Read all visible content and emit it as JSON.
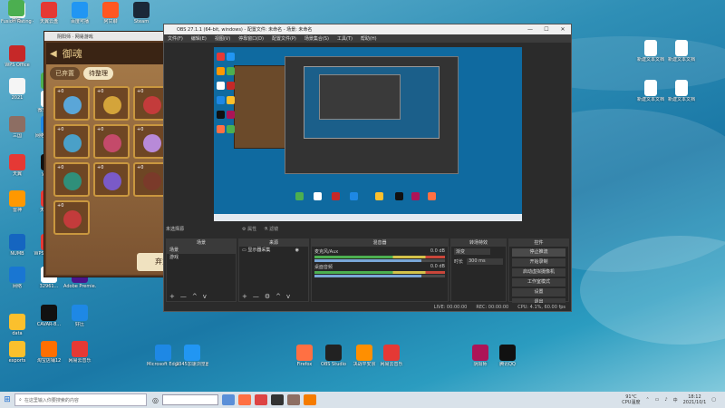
{
  "desktop_icons_left": [
    {
      "label": "Fusion Rating 4",
      "color": "#ffffff"
    },
    {
      "label": "天翼云盘",
      "color": "#e53935"
    },
    {
      "label": "百度可播",
      "color": "#2196f3"
    },
    {
      "label": "阿甘聊",
      "color": "#ff5722"
    },
    {
      "label": "Steam",
      "color": "#1b2838"
    },
    {
      "label": "WPS Office",
      "color": "#c62828"
    },
    {
      "label": "微信",
      "color": "#4caf50"
    },
    {
      "label": "2021",
      "color": "#f5f5f5"
    },
    {
      "label": "微软输入法",
      "color": "#ffffff"
    },
    {
      "label": "三国",
      "color": "#8d6e63"
    },
    {
      "label": "网络电视直播",
      "color": "#1e88e5"
    },
    {
      "label": "天翼",
      "color": "#e53935"
    },
    {
      "label": "yyskia",
      "color": "#111111"
    },
    {
      "label": "雷神",
      "color": "#ff9800"
    },
    {
      "label": "天翼云盘",
      "color": "#e53935"
    },
    {
      "label": "NUMB",
      "color": "#1565c0"
    },
    {
      "label": "WPS图片-客户",
      "color": "#e53935"
    },
    {
      "label": "网络",
      "color": "#1976d2"
    },
    {
      "label": "32961...",
      "color": "#ffffff"
    },
    {
      "label": "Adobe Premie...",
      "color": "#4a148c"
    },
    {
      "label": "data",
      "color": "#fbc02d"
    },
    {
      "label": "CAVAR-8...",
      "color": "#111111"
    },
    {
      "label": "好压",
      "color": "#1e88e5"
    },
    {
      "label": "exports",
      "color": "#fbc02d"
    },
    {
      "label": "淘宝店铺12",
      "color": "#ff6f00"
    },
    {
      "label": "网易云音乐",
      "color": "#e53935"
    },
    {
      "label": "Microsoft Edge",
      "color": "#1e88e5"
    },
    {
      "label": "2345加速浏览器",
      "color": "#2196f3"
    },
    {
      "label": "Firefox",
      "color": "#ff7043"
    },
    {
      "label": "OBS Studio",
      "color": "#222222"
    },
    {
      "label": "决战平安京",
      "color": "#ff8f00"
    },
    {
      "label": "网易云音乐",
      "color": "#e53935"
    },
    {
      "label": "阴阳师",
      "color": "#ad1457"
    },
    {
      "label": "腾讯QQ",
      "color": "#111111"
    },
    {
      "label": "微信",
      "color": "#4caf50"
    }
  ],
  "desktop_icons_right": [
    {
      "label": "新建文本文档",
      "color": "#ffffff"
    },
    {
      "label": "新建文本文档",
      "color": "#ffffff"
    },
    {
      "label": "",
      "color": "#a5d6a7"
    },
    {
      "label": "新建文本文档",
      "color": "#ffffff"
    },
    {
      "label": "新建文本文档",
      "color": "#ffffff"
    }
  ],
  "game": {
    "window_title": "阴阳师 · 网易游戏",
    "header": "御魂",
    "count": "43",
    "tabs": [
      "已弃置",
      "待整理"
    ],
    "level_prefix": "+0",
    "cells": [
      "#5aa6d8",
      "#d4a43a",
      "#c33b3b",
      "#4aa0c8",
      "#c44a6a",
      "#b88ad8",
      "#2f8f7a",
      "#7a5ac8",
      "#7a3a2a",
      "#c33b3b"
    ],
    "discard_button": "弃置"
  },
  "obs": {
    "title": "OBS 27.1.1 (64-bit, windows) - 配置文件: 未命名 - 场景: 未命名",
    "menu": [
      "文件(F)",
      "编辑(E)",
      "视图(V)",
      "停靠窗口(D)",
      "配置文件(P)",
      "场景集合(S)",
      "工具(T)",
      "帮助(H)"
    ],
    "window_controls": [
      "—",
      "☐",
      "✕"
    ],
    "scene_area_label": "未选择源",
    "scene_toolbar": [
      "属性",
      "滤镜"
    ],
    "docks": {
      "scenes": {
        "title": "场景",
        "items": [
          "场景",
          "游戏"
        ]
      },
      "sources": {
        "title": "来源",
        "items": [
          "显示器采集"
        ]
      },
      "mixer": {
        "title": "混音器",
        "channels": [
          {
            "name": "麦克风/Aux",
            "db": "0.0 dB",
            "volume": 0.82
          },
          {
            "name": "桌面音频",
            "db": "0.0 dB",
            "volume": 0.82
          }
        ]
      },
      "transitions": {
        "title": "转场特效",
        "type_label": "渐变",
        "duration_label": "时长",
        "duration_value": "300 ms"
      },
      "controls": {
        "title": "控件",
        "buttons": [
          "停止推流",
          "开始录制",
          "启动虚拟摄像机",
          "工作室模式",
          "设置",
          "退出"
        ]
      }
    },
    "footer_symbols": [
      "+",
      "—",
      "^",
      "v"
    ],
    "status": [
      "LIVE: 00:00:00",
      "REC: 00:00:00",
      "CPU: 4.1%, 60.00 fps"
    ]
  },
  "taskbar": {
    "search_placeholder": "在这里输入你要搜索的内容",
    "apps": [
      "#5a8fd8",
      "#ff7043",
      "#d44",
      "#333333",
      "#8d6e63",
      "#f57c00"
    ],
    "temperature": "91°C",
    "temperature_label": "CPU温度",
    "language": "中",
    "time": "18:12",
    "date": "2021/10/1"
  }
}
